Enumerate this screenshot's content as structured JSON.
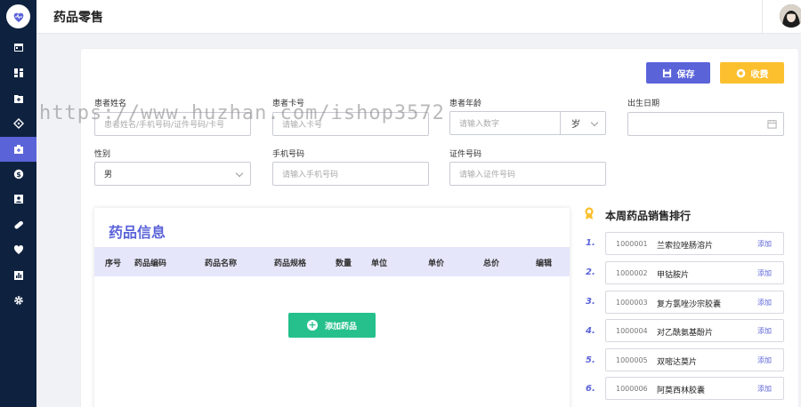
{
  "header": {
    "title": "药品零售"
  },
  "toolbar": {
    "save_label": "保存",
    "charge_label": "收费"
  },
  "form": {
    "name": {
      "label": "患者姓名",
      "placeholder": "患者姓名/手机号码/证件号码/卡号"
    },
    "card": {
      "label": "患者卡号",
      "placeholder": "请输入卡号"
    },
    "age": {
      "label": "患者年龄",
      "placeholder": "请输入数字",
      "unit": "岁"
    },
    "birth": {
      "label": "出生日期",
      "value": ""
    },
    "gender": {
      "label": "性别",
      "value": "男"
    },
    "phone": {
      "label": "手机号码",
      "placeholder": "请输入手机号码"
    },
    "idno": {
      "label": "证件号码",
      "placeholder": "请输入证件号码"
    }
  },
  "medicine": {
    "title": "药品信息",
    "columns": [
      "序号",
      "药品编码",
      "药品名称",
      "药品规格",
      "数量",
      "单位",
      "单价",
      "总价",
      "编辑"
    ],
    "add_label": "添加药品"
  },
  "ranking": {
    "title": "本周药品销售排行",
    "items": [
      {
        "rank": "1.",
        "code": "1000001",
        "name": "兰索拉唑肠溶片",
        "action": "添加"
      },
      {
        "rank": "2.",
        "code": "1000002",
        "name": "甲钴胺片",
        "action": "添加"
      },
      {
        "rank": "3.",
        "code": "1000003",
        "name": "复方氯唑沙宗胶囊",
        "action": "添加"
      },
      {
        "rank": "4.",
        "code": "1000004",
        "name": "对乙酰氨基酚片",
        "action": "添加"
      },
      {
        "rank": "5.",
        "code": "1000005",
        "name": "双嘧达莫片",
        "action": "添加"
      },
      {
        "rank": "6.",
        "code": "1000006",
        "name": "阿莫西林胶囊",
        "action": "添加"
      }
    ]
  },
  "watermark": "https://www.huzhan.com/ishop3572",
  "colors": {
    "sidebar": "#0e2240",
    "accent": "#5b63d9",
    "charge": "#fcc02f",
    "add": "#25c08c"
  }
}
